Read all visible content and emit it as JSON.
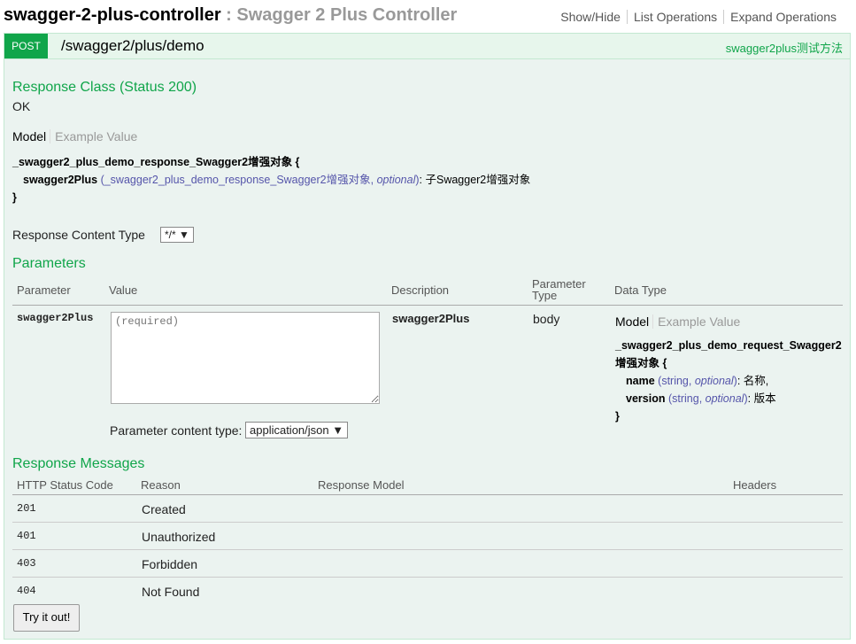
{
  "header": {
    "controller_name": "swagger-2-plus-controller",
    "separator": " : ",
    "controller_desc": "Swagger 2 Plus Controller",
    "links": [
      "Show/Hide",
      "List Operations",
      "Expand Operations"
    ]
  },
  "operation": {
    "method": "POST",
    "path": "/swagger2/plus/demo",
    "summary": "swagger2plus测试方法"
  },
  "response_class": {
    "title": "Response Class (Status 200)",
    "status_text": "OK",
    "tab_model": "Model",
    "tab_example": "Example Value",
    "model_name": "_swagger2_plus_demo_response_Swagger2增强对象 {",
    "field_name": "swagger2Plus",
    "field_type": "_swagger2_plus_demo_response_Swagger2增强对象",
    "field_optional": "optional",
    "field_desc": ": 子Swagger2增强对象",
    "close": "}"
  },
  "response_content_type": {
    "label": "Response Content Type",
    "value": "*/*"
  },
  "parameters": {
    "title": "Parameters",
    "headers": [
      "Parameter",
      "Value",
      "Description",
      "Parameter Type",
      "Data Type"
    ],
    "row": {
      "name": "swagger2Plus",
      "placeholder": "(required)",
      "description": "swagger2Plus",
      "type": "body",
      "tab_model": "Model",
      "tab_example": "Example Value",
      "model_name_1": "_swagger2_plus_demo_request_Swagger2",
      "model_name_2": "增强对象 {",
      "f1_name": "name",
      "f1_type": "string",
      "f1_optional": "optional",
      "f1_desc": ": 名称,",
      "f2_name": "version",
      "f2_type": "string",
      "f2_optional": "optional",
      "f2_desc": ": 版本",
      "close": "}"
    },
    "content_type_label": "Parameter content type:",
    "content_type_value": "application/json"
  },
  "response_messages": {
    "title": "Response Messages",
    "headers": [
      "HTTP Status Code",
      "Reason",
      "Response Model",
      "Headers"
    ],
    "rows": [
      {
        "code": "201",
        "reason": "Created"
      },
      {
        "code": "401",
        "reason": "Unauthorized"
      },
      {
        "code": "403",
        "reason": "Forbidden"
      },
      {
        "code": "404",
        "reason": "Not Found"
      }
    ]
  },
  "try_button": "Try it out!"
}
